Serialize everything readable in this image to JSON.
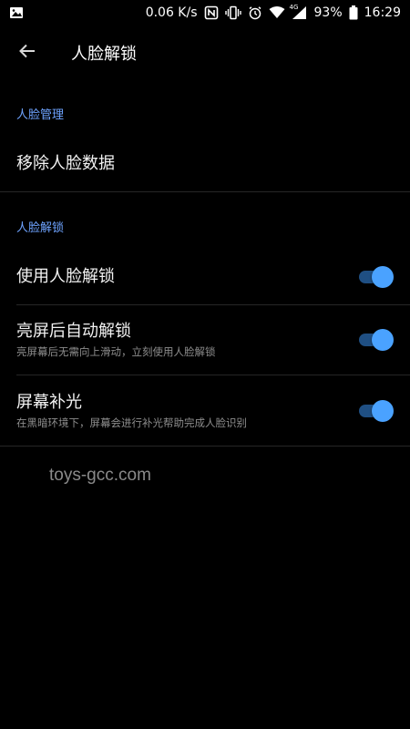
{
  "status_bar": {
    "network_speed": "0.06 K/s",
    "network_badge": "4G",
    "battery_percent": "93%",
    "time": "16:29",
    "icons": [
      "image-icon",
      "nfc-icon",
      "vibrate-icon",
      "alarm-icon",
      "wifi-icon",
      "cellular-signal-icon",
      "battery-icon"
    ]
  },
  "app_bar": {
    "title": "人脸解锁"
  },
  "sections": [
    {
      "header": "人脸管理",
      "items": [
        {
          "title": "移除人脸数据"
        }
      ]
    },
    {
      "header": "人脸解锁",
      "items": [
        {
          "title": "使用人脸解锁",
          "toggle_on": true
        },
        {
          "title": "亮屏后自动解锁",
          "summary": "亮屏幕后无需向上滑动，立刻使用人脸解锁",
          "toggle_on": true
        },
        {
          "title": "屏幕补光",
          "summary": "在黑暗环境下，屏幕会进行补光帮助完成人脸识别",
          "toggle_on": true
        }
      ]
    }
  ],
  "watermark": "toys-gcc.com",
  "colors": {
    "background": "#000000",
    "accent": "#4aa2ff",
    "section_header": "#6ea3ff",
    "summary_text": "#8d8d8d"
  }
}
